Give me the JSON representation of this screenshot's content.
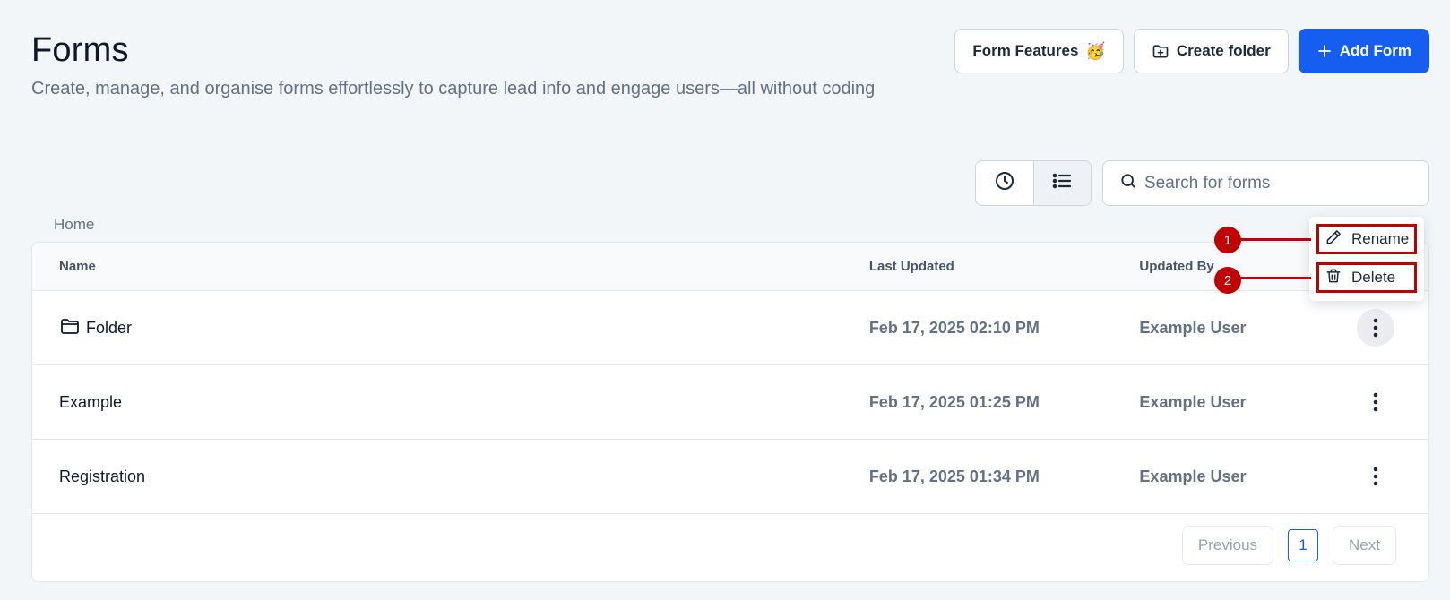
{
  "header": {
    "title": "Forms",
    "subtitle": "Create, manage, and organise forms effortlessly to capture lead info and engage users—all without coding"
  },
  "actions": {
    "form_features_label": "Form Features",
    "form_features_emoji": "🥳",
    "create_folder_label": "Create folder",
    "add_form_label": "Add Form"
  },
  "search": {
    "placeholder": "Search for forms"
  },
  "breadcrumb": "Home",
  "table": {
    "columns": [
      "Name",
      "Last Updated",
      "Updated By"
    ],
    "rows": [
      {
        "name": "Folder",
        "updated": "Feb 17, 2025 02:10 PM",
        "by": "Example User",
        "icon": "folder-icon"
      },
      {
        "name": "Example",
        "updated": "Feb 17, 2025 01:25 PM",
        "by": "Example User"
      },
      {
        "name": "Registration",
        "updated": "Feb 17, 2025 01:34 PM",
        "by": "Example User"
      }
    ]
  },
  "pagination": {
    "previous_label": "Previous",
    "current_page": "1",
    "next_label": "Next"
  },
  "context_menu": {
    "items": [
      {
        "label": "Rename",
        "icon": "pencil-icon"
      },
      {
        "label": "Delete",
        "icon": "trash-icon"
      }
    ]
  },
  "annotations": [
    "1",
    "2"
  ],
  "colors": {
    "primary": "#155eef",
    "annotation": "#c00000",
    "background": "#f3f6f9"
  }
}
